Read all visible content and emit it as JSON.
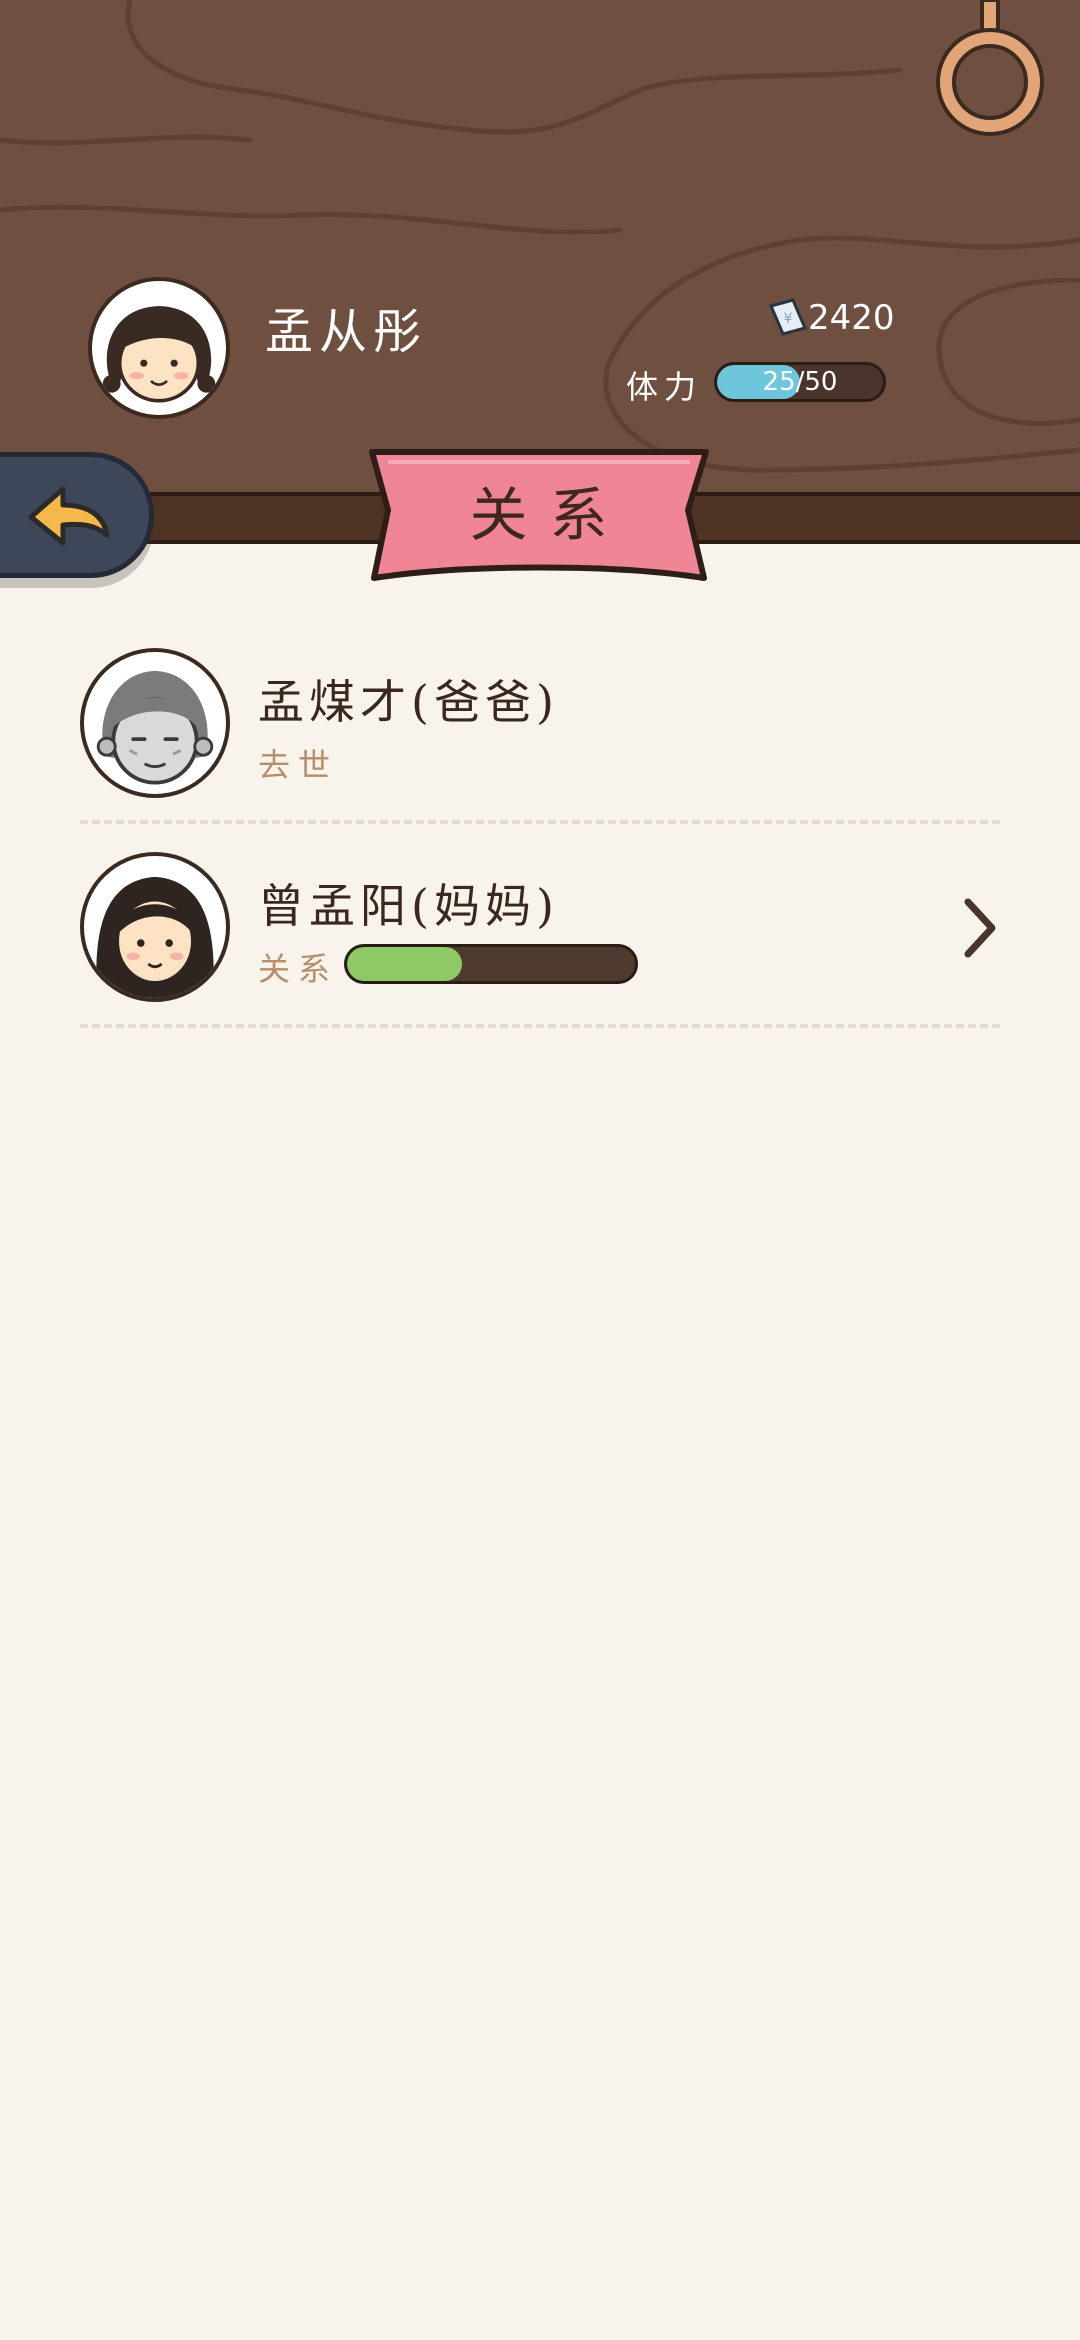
{
  "header": {
    "player_name": "孟从彤",
    "money_icon": "banknote-icon",
    "money": "2420",
    "stamina_label": "体力",
    "stamina_text": "25/50",
    "stamina_current": 25,
    "stamina_max": 50
  },
  "nav": {
    "back_icon": "back-arrow-icon",
    "title": "关系"
  },
  "relations": [
    {
      "name": "孟煤才(爸爸)",
      "status": "去世"
    },
    {
      "name": "曾孟阳(妈妈)",
      "status": "关系",
      "relation_level": 0.4,
      "chevron_icon": "chevron-right-icon"
    }
  ],
  "colors": {
    "wood": "#6f4f40",
    "banner": "#f08596",
    "stamina": "#6ec6dc",
    "relation": "#8fc965",
    "background": "#f8f4ec"
  }
}
